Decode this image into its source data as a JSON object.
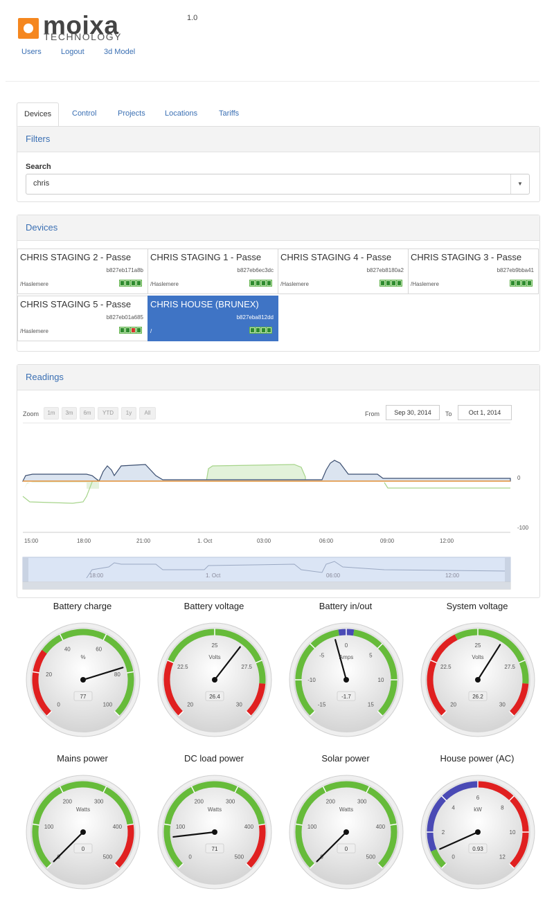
{
  "brand": {
    "name": "moixa",
    "sub": "TECHNOLOGY",
    "version": "1.0"
  },
  "topnav": [
    {
      "label": "Users"
    },
    {
      "label": "Logout"
    },
    {
      "label": "3d Model"
    }
  ],
  "tabs": [
    {
      "label": "Devices",
      "active": true
    },
    {
      "label": "Control"
    },
    {
      "label": "Projects"
    },
    {
      "label": "Locations"
    },
    {
      "label": "Tariffs"
    }
  ],
  "filters": {
    "title": "Filters",
    "search_label": "Search",
    "search_value": "chris"
  },
  "devices": {
    "title": "Devices",
    "items": [
      {
        "name": "CHRIS STAGING 2 - Passe",
        "id": "b827eb171a8b",
        "location": "/Haslemere",
        "status": [
          "g",
          "g",
          "g",
          "g"
        ]
      },
      {
        "name": "CHRIS STAGING 1 - Passe",
        "id": "b827eb6ec3dc",
        "location": "/Haslemere",
        "status": [
          "g",
          "g",
          "g",
          "g"
        ]
      },
      {
        "name": "CHRIS STAGING 4 - Passe",
        "id": "b827eb8180a2",
        "location": "/Haslemere",
        "status": [
          "g",
          "g",
          "g",
          "g"
        ]
      },
      {
        "name": "CHRIS STAGING 3 - Passe",
        "id": "b827eb9bba41",
        "location": "/Haslemere",
        "status": [
          "g",
          "g",
          "g",
          "g"
        ]
      },
      {
        "name": "CHRIS STAGING 5 - Passe",
        "id": "b827eb01a685",
        "location": "/Haslemere",
        "status": [
          "g",
          "g",
          "r",
          "g"
        ]
      },
      {
        "name": "CHRIS HOUSE (BRUNEX)",
        "id": "b827eba812dd",
        "location": "/",
        "status": [
          "g",
          "g",
          "g",
          "g"
        ],
        "selected": true
      }
    ]
  },
  "readings": {
    "title": "Readings",
    "zoom_label": "Zoom",
    "zoom_buttons": [
      "1m",
      "3m",
      "6m",
      "YTD",
      "1y",
      "All"
    ],
    "from_label": "From",
    "from_value": "Sep 30, 2014",
    "to_label": "To",
    "to_value": "Oct 1, 2014",
    "y_labels": [
      "0",
      "-100"
    ],
    "x_labels": [
      "15:00",
      "18:00",
      "21:00",
      "1. Oct",
      "03:00",
      "06:00",
      "09:00",
      "12:00"
    ],
    "nav_labels": [
      "18:00",
      "1. Oct",
      "06:00",
      "12:00"
    ]
  },
  "gauges": [
    {
      "title": "Battery charge",
      "unit": "%",
      "value": "77",
      "min": 0,
      "max": 100,
      "v": 77,
      "ticks": [
        "0",
        "20",
        "40",
        "60",
        "80",
        "100"
      ],
      "bands": [
        [
          "#e02020",
          0,
          30
        ],
        [
          "#66bb3a",
          30,
          100
        ]
      ]
    },
    {
      "title": "Battery voltage",
      "unit": "Volts",
      "value": "26.4",
      "min": 20,
      "max": 30,
      "v": 26.4,
      "ticks": [
        "20",
        "22.5",
        "25",
        "27.5",
        "30"
      ],
      "bands": [
        [
          "#e02020",
          20,
          22.5
        ],
        [
          "#66bb3a",
          22.5,
          28.5
        ],
        [
          "#e02020",
          28.5,
          30
        ]
      ]
    },
    {
      "title": "Battery in/out",
      "unit": "Amps",
      "value": "-1.7",
      "min": -15,
      "max": 15,
      "v": -1.7,
      "ticks": [
        "-15",
        "-10",
        "-5",
        "0",
        "5",
        "10",
        "15"
      ],
      "bands": [
        [
          "#66bb3a",
          -15,
          -1
        ],
        [
          "#4a4ab5",
          -1,
          1
        ],
        [
          "#66bb3a",
          1,
          15
        ]
      ]
    },
    {
      "title": "System voltage",
      "unit": "Volts",
      "value": "26.2",
      "min": 20,
      "max": 30,
      "v": 26.2,
      "ticks": [
        "20",
        "22.5",
        "25",
        "27.5",
        "30"
      ],
      "bands": [
        [
          "#e02020",
          20,
          24
        ],
        [
          "#66bb3a",
          24,
          28.5
        ],
        [
          "#e02020",
          28.5,
          30
        ]
      ]
    },
    {
      "title": "Mains power",
      "unit": "Watts",
      "value": "0",
      "min": 0,
      "max": 500,
      "v": 0,
      "ticks": [
        "0",
        "100",
        "200",
        "300",
        "400",
        "500"
      ],
      "bands": [
        [
          "#66bb3a",
          0,
          400
        ],
        [
          "#e02020",
          400,
          500
        ]
      ]
    },
    {
      "title": "DC load power",
      "unit": "Watts",
      "value": "71",
      "min": 0,
      "max": 500,
      "v": 71,
      "ticks": [
        "0",
        "100",
        "200",
        "300",
        "400",
        "500"
      ],
      "bands": [
        [
          "#66bb3a",
          0,
          400
        ],
        [
          "#e02020",
          400,
          500
        ]
      ]
    },
    {
      "title": "Solar power",
      "unit": "Watts",
      "value": "0",
      "min": 0,
      "max": 500,
      "v": 0,
      "ticks": [
        "0",
        "100",
        "200",
        "300",
        "400",
        "500"
      ],
      "bands": [
        [
          "#66bb3a",
          0,
          500
        ]
      ]
    },
    {
      "title": "House power (AC)",
      "unit": "kW",
      "value": "0.93",
      "min": 0,
      "max": 12,
      "v": 0.93,
      "ticks": [
        "0",
        "2",
        "4",
        "6",
        "8",
        "10",
        "12"
      ],
      "bands": [
        [
          "#66bb3a",
          0,
          1
        ],
        [
          "#4a4ab5",
          1,
          6
        ],
        [
          "#e02020",
          6,
          12
        ]
      ]
    }
  ]
}
